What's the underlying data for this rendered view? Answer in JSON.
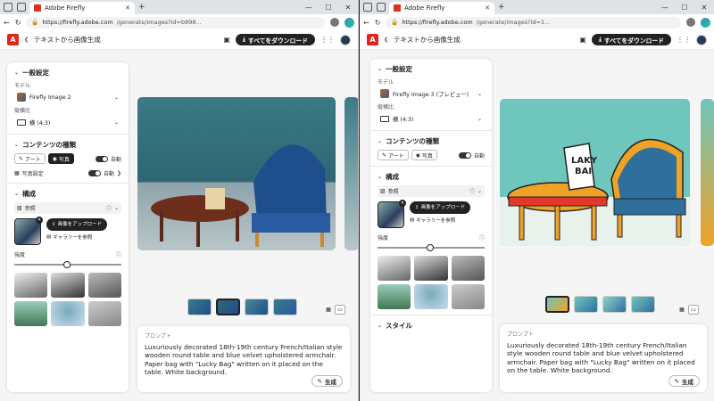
{
  "windows": [
    {
      "tab_title": "Adobe Firefly",
      "url_host": "https://firefly.adobe.com",
      "url_path": "/generate/images?id=b898...",
      "header_title": "テキストから画像生成",
      "download_label": "すべてをダウンロード",
      "general_settings": "一般設定",
      "model_label": "モデル",
      "model_value": "Firefly Image 2",
      "aspect_label": "縦横比",
      "aspect_value": "横 (4:3)",
      "content_type": "コンテンツの種類",
      "art_label": "アート",
      "photo_label": "写真",
      "auto_label": "自動",
      "photo_settings": "写真設定",
      "composition": "構成",
      "reference_label": "参照",
      "upload_label": "画像をアップロード",
      "gallery_label": "ギャラリーを参照",
      "strength_label": "強度",
      "prompt_label": "プロンプト",
      "prompt_text": "Luxuriously decorated 18th-19th century French/Italian style wooden round table and blue velvet upholstered armchair. Paper bag with \"Lucky Bag\" written on it placed on the table. White background.",
      "generate_label": "生成"
    },
    {
      "tab_title": "Adobe Firefly",
      "url_host": "https://firefly.adobe.com",
      "url_path": "/generate/images?id=1...",
      "header_title": "テキストから画像生成",
      "download_label": "すべてをダウンロード",
      "general_settings": "一般設定",
      "model_label": "モデル",
      "model_value": "Firefly Image 3 (プレビュー)",
      "aspect_label": "縦横比",
      "aspect_value": "横 (4:3)",
      "content_type": "コンテンツの種類",
      "art_label": "アート",
      "photo_label": "写真",
      "auto_label": "自動",
      "composition": "構成",
      "reference_label": "参照",
      "upload_label": "画像をアップロード",
      "gallery_label": "ギャラリーを参照",
      "strength_label": "強度",
      "style_label": "スタイル",
      "prompt_label": "プロンプト",
      "prompt_text": "Luxuriously decorated 18th-19th century French/Italian style wooden round table and blue velvet upholstered armchair. Paper bag with \"Lucky Bag\" written on it placed on the table. White background.",
      "generate_label": "生成",
      "bag_text_1": "LAKY",
      "bag_text_2": "BAI"
    }
  ],
  "colors": {
    "adobe_red": "#e1251b",
    "dark_button": "#222222"
  },
  "icons": [
    "back-icon",
    "refresh-icon",
    "chat-icon",
    "apps-grid-icon",
    "download-icon",
    "info-icon",
    "close-icon",
    "upload-icon",
    "gallery-icon",
    "generate-icon",
    "grid-view-icon",
    "single-view-icon"
  ]
}
